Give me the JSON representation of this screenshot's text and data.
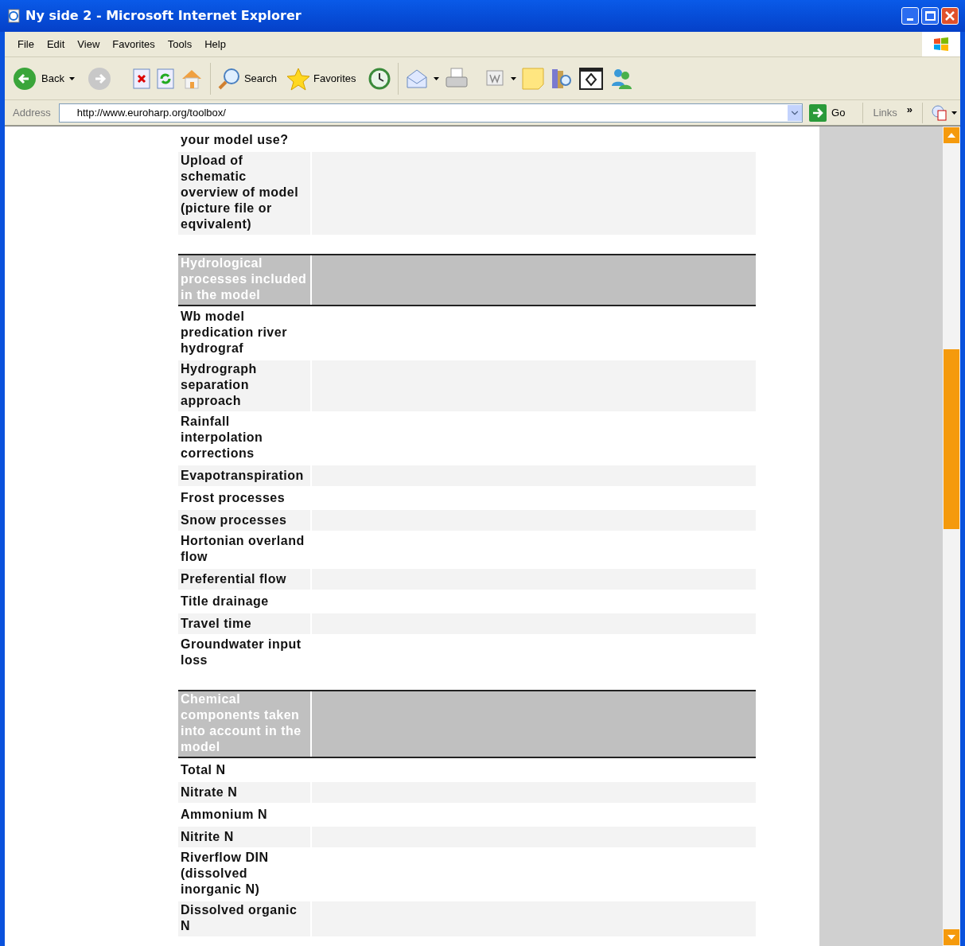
{
  "window": {
    "title": "Ny side 2 - Microsoft Internet Explorer"
  },
  "menu": [
    "File",
    "Edit",
    "View",
    "Favorites",
    "Tools",
    "Help"
  ],
  "toolbar": {
    "back": "Back",
    "search": "Search",
    "favorites": "Favorites"
  },
  "address_bar": {
    "label": "Address",
    "value": "http://www.euroharp.org/toolbox/",
    "go": "Go",
    "links": "Links",
    "chevron": "»"
  },
  "sections": [
    {
      "rows": [
        {
          "label": "your model use?",
          "shaded": false
        },
        {
          "label": "Upload of schematic overview of model (picture file or eqvivalent)",
          "shaded": true
        }
      ]
    },
    {
      "header": "Hydrological processes included in the model",
      "rows": [
        {
          "label": "Wb model predication river hydrograf",
          "shaded": false
        },
        {
          "label": "Hydrograph separation approach",
          "shaded": true
        },
        {
          "label": "Rainfall interpolation corrections",
          "shaded": false
        },
        {
          "label": "Evapotranspiration",
          "shaded": true
        },
        {
          "label": "Frost processes",
          "shaded": false
        },
        {
          "label": "Snow processes",
          "shaded": true
        },
        {
          "label": "Hortonian overland flow",
          "shaded": false
        },
        {
          "label": "Preferential flow",
          "shaded": true
        },
        {
          "label": "Title drainage",
          "shaded": false
        },
        {
          "label": "Travel time",
          "shaded": true
        },
        {
          "label": "Groundwater input loss",
          "shaded": false
        }
      ]
    },
    {
      "header": "Chemical components taken into account in the model",
      "rows": [
        {
          "label": "Total N",
          "shaded": false
        },
        {
          "label": "Nitrate N",
          "shaded": true
        },
        {
          "label": "Ammonium N",
          "shaded": false
        },
        {
          "label": "Nitrite N",
          "shaded": true
        },
        {
          "label": "Riverflow DIN (dissolved inorganic N)",
          "shaded": false
        },
        {
          "label": "Dissolved organic N",
          "shaded": true
        }
      ]
    }
  ]
}
